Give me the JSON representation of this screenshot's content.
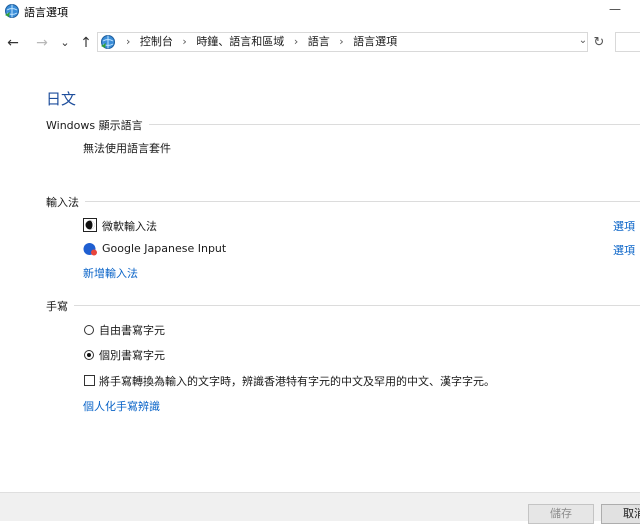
{
  "window": {
    "title": "語言選項",
    "minimize_glyph": "—"
  },
  "nav": {
    "back_glyph": "←",
    "forward_glyph": "→",
    "recent_glyph": "⌄",
    "up_glyph": "↑",
    "crumb_sep": "›",
    "breadcrumbs": [
      "控制台",
      "時鐘、語言和區域",
      "語言",
      "語言選項"
    ],
    "dropdown_glyph": "⌄",
    "refresh_glyph": "↻"
  },
  "page": {
    "title": "日文"
  },
  "display_language": {
    "heading": "Windows 顯示語言",
    "status": "無法使用語言套件"
  },
  "input_methods": {
    "heading": "輸入法",
    "items": [
      {
        "name": "微軟輸入法",
        "icon": "microsoft-ime-icon",
        "options_label": "選項"
      },
      {
        "name": "Google Japanese Input",
        "icon": "google-ime-icon",
        "options_label": "選項"
      }
    ],
    "add_link": "新增輸入法"
  },
  "handwriting": {
    "heading": "手寫",
    "radio_freeform": "自由書寫字元",
    "radio_individual": "個別書寫字元",
    "selected": "individual",
    "checkbox_label": "將手寫轉換為輸入的文字時，辨識香港特有字元的中文及罕用的中文、漢字字元。",
    "checkbox_checked": false,
    "personalize_link": "個人化手寫辨識"
  },
  "footer": {
    "save_label": "儲存",
    "cancel_label": "取消"
  },
  "colors": {
    "title_blue": "#1e4e9c",
    "link_blue": "#0a64c8"
  }
}
